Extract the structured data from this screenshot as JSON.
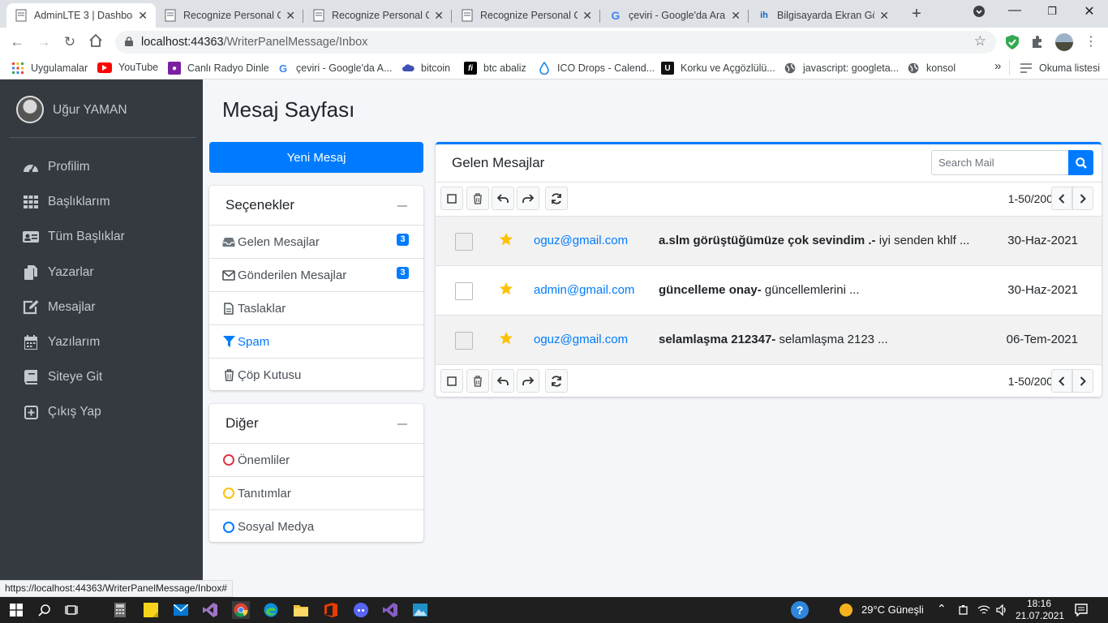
{
  "browser": {
    "tabs": [
      {
        "title": "AdminLTE 3 | Dashboa",
        "active": true
      },
      {
        "title": "Recognize Personal Ca",
        "active": false
      },
      {
        "title": "Recognize Personal Ca",
        "active": false
      },
      {
        "title": "Recognize Personal Ca",
        "active": false
      },
      {
        "title": "çeviri - Google'da Ara",
        "active": false
      },
      {
        "title": "Bilgisayarda Ekran Gör",
        "active": false
      }
    ],
    "url_host": "localhost:44363",
    "url_path": "/WriterPanelMessage/Inbox",
    "bookmarks": [
      {
        "label": "Uygulamalar",
        "icon": "apps-grid-icon"
      },
      {
        "label": "YouTube",
        "icon": "youtube-icon"
      },
      {
        "label": "Canlı Radyo Dinle",
        "icon": "radio-icon"
      },
      {
        "label": "çeviri - Google'da A...",
        "icon": "google-icon"
      },
      {
        "label": "bitcoin",
        "icon": "cloud-icon"
      },
      {
        "label": "btc abaliz",
        "icon": "fi-icon"
      },
      {
        "label": "ICO Drops - Calend...",
        "icon": "drop-icon"
      },
      {
        "label": "Korku ve Açgözlülü...",
        "icon": "u-icon"
      },
      {
        "label": "javascript: googleta...",
        "icon": "globe-icon"
      },
      {
        "label": "konsol",
        "icon": "globe-icon"
      }
    ],
    "bookmarks_overflow": "»",
    "reading_list": "Okuma listesi",
    "status_url": "https://localhost:44363/WriterPanelMessage/Inbox#"
  },
  "sidebar": {
    "user_name": "Uğur YAMAN",
    "items": [
      {
        "label": "Profilim",
        "icon": "tachometer-icon"
      },
      {
        "label": "Başlıklarım",
        "icon": "th-grid-icon"
      },
      {
        "label": "Tüm Başlıklar",
        "icon": "id-card-icon"
      },
      {
        "label": "Yazarlar",
        "icon": "copy-icon"
      },
      {
        "label": "Mesajlar",
        "icon": "edit-icon"
      },
      {
        "label": "Yazılarım",
        "icon": "calendar-icon"
      },
      {
        "label": "Siteye Git",
        "icon": "book-icon"
      },
      {
        "label": "Çıkış Yap",
        "icon": "plus-square-icon"
      }
    ]
  },
  "page": {
    "title": "Mesaj Sayfası",
    "compose_label": "Yeni Mesaj"
  },
  "folders": {
    "title": "Seçenekler",
    "items": [
      {
        "label": "Gelen Mesajlar",
        "icon": "inbox-icon",
        "badge": "3"
      },
      {
        "label": "Gönderilen Mesajlar",
        "icon": "envelope-icon",
        "badge": "3"
      },
      {
        "label": "Taslaklar",
        "icon": "file-icon"
      },
      {
        "label": "Spam",
        "icon": "filter-icon",
        "active": true
      },
      {
        "label": "Çöp Kutusu",
        "icon": "trash-icon"
      }
    ]
  },
  "labels": {
    "title": "Diğer",
    "items": [
      {
        "label": "Önemliler",
        "icon": "circle-icon",
        "color": "#dc3545"
      },
      {
        "label": "Tanıtımlar",
        "icon": "circle-icon",
        "color": "#ffc107"
      },
      {
        "label": "Sosyal Medya",
        "icon": "circle-icon",
        "color": "#007bff"
      }
    ]
  },
  "mailbox": {
    "title": "Gelen Mesajlar",
    "search_placeholder": "Search Mail",
    "pager": "1-50/200",
    "messages": [
      {
        "sender": "oguz@gmail.com",
        "subject": "a.slm görüştüğümüze çok sevindim .-",
        "preview": " iyi senden khlf ...",
        "date": "30-Haz-2021",
        "starred": true
      },
      {
        "sender": "admin@gmail.com",
        "subject": "güncelleme onay-",
        "preview": " güncellemlerini ...",
        "date": "30-Haz-2021",
        "starred": true
      },
      {
        "sender": "oguz@gmail.com",
        "subject": "selamlaşma 212347-",
        "preview": " selamlaşma 2123 ...",
        "date": "06-Tem-2021",
        "starred": true
      }
    ]
  },
  "taskbar": {
    "weather": "29°C  Güneşli",
    "time": "18:16",
    "date": "21.07.2021"
  },
  "colors": {
    "primary": "#007bff",
    "sidebar_bg": "#343a40",
    "star": "#ffc107"
  }
}
